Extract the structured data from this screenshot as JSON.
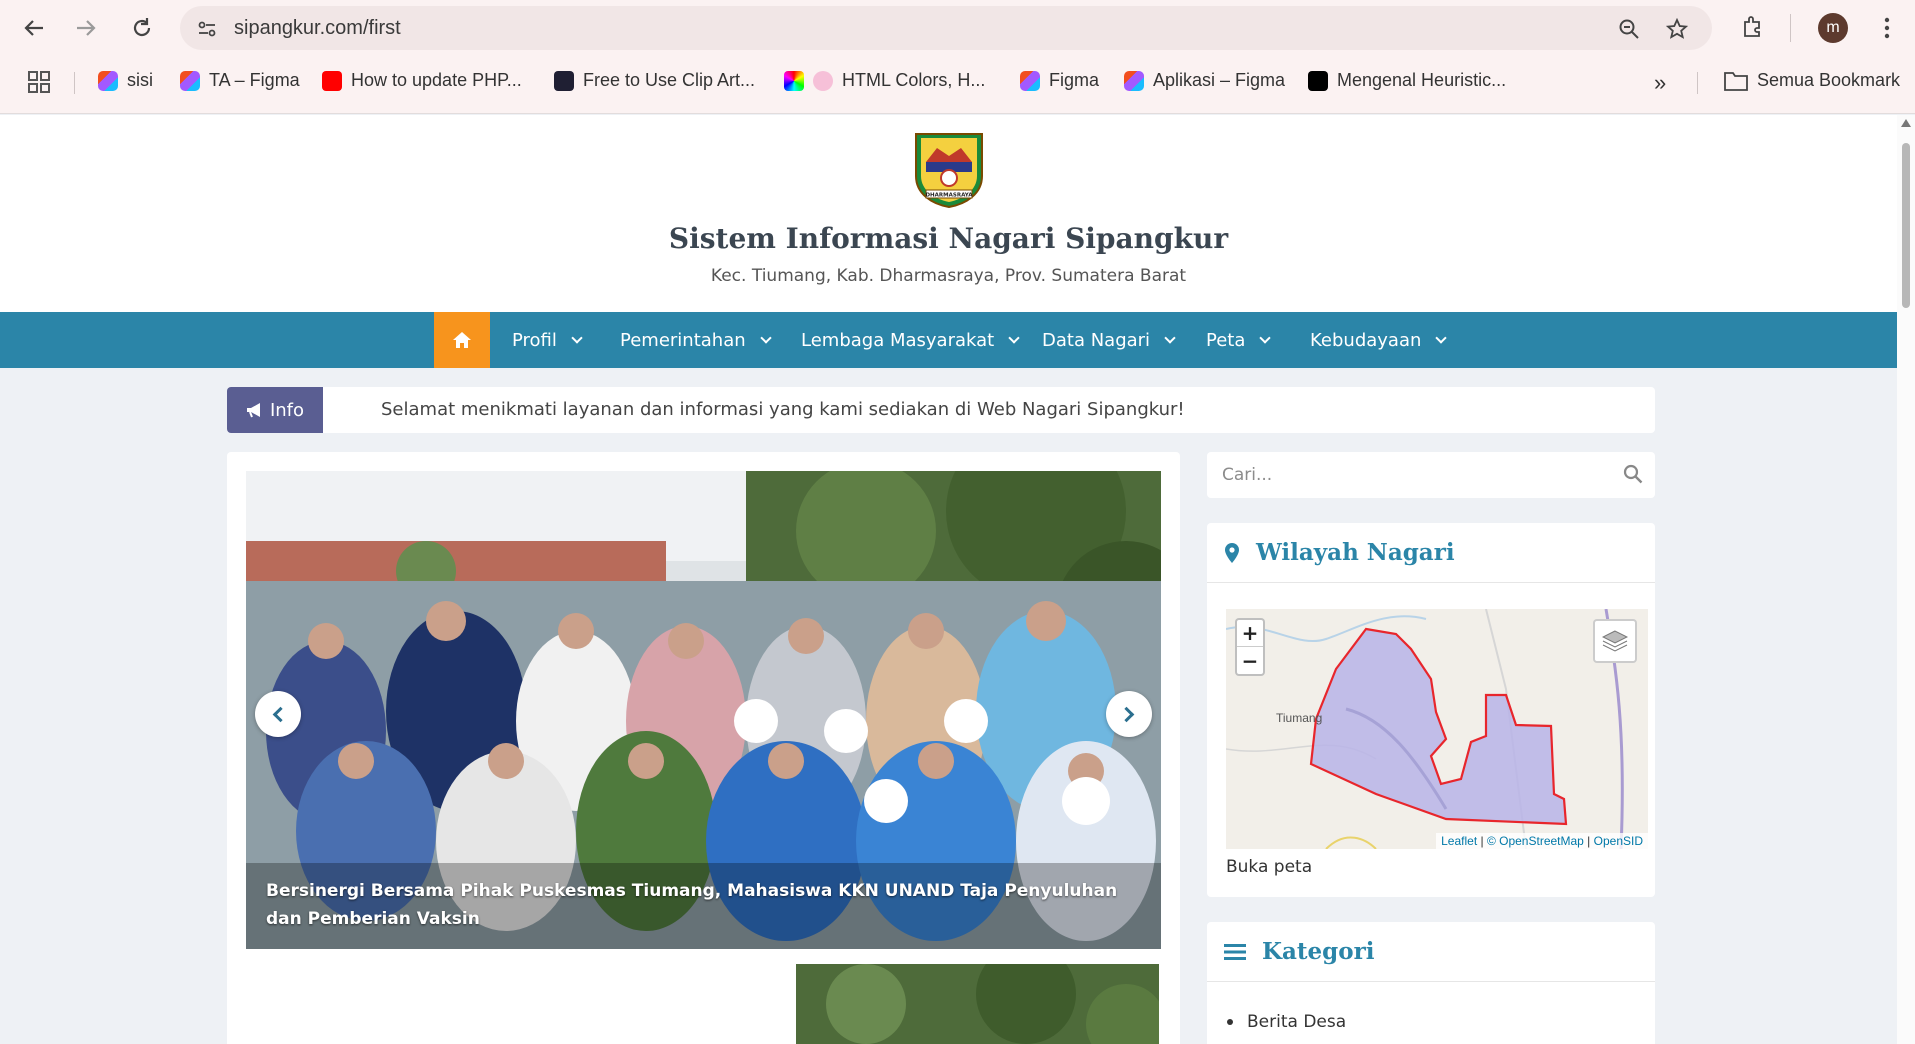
{
  "browser": {
    "url": "sipangkur.com/first",
    "profile_initial": "m",
    "bookmarks": [
      {
        "label": "sisi",
        "icon": "figma"
      },
      {
        "label": "TA – Figma",
        "icon": "figma"
      },
      {
        "label": "How to update PHP...",
        "icon": "youtube"
      },
      {
        "label": "Free to Use Clip Art...",
        "icon": "site"
      },
      {
        "label": "HTML Colors, H...",
        "icon": "colors"
      },
      {
        "label": "Figma",
        "icon": "figma"
      },
      {
        "label": "Aplikasi – Figma",
        "icon": "figma"
      },
      {
        "label": "Mengenal Heuristic...",
        "icon": "medium"
      }
    ],
    "all_bookmarks_label": "Semua Bookmark"
  },
  "site": {
    "title": "Sistem Informasi Nagari Sipangkur",
    "subtitle": "Kec. Tiumang, Kab. Dharmasraya, Prov. Sumatera Barat",
    "logo_text": "DHARMASRAYA"
  },
  "menu": {
    "items": [
      "Profil",
      "Pemerintahan",
      "Lembaga Masyarakat",
      "Data Nagari",
      "Peta",
      "Kebudayaan"
    ]
  },
  "info": {
    "badge": "Info",
    "text": "Selamat menikmati layanan dan informasi yang kami sediakan di Web Nagari Sipangkur!"
  },
  "slider": {
    "caption": "Bersinergi Bersama Pihak Puskesmas Tiumang, Mahasiswa KKN UNAND Taja Penyuluhan dan Pemberian Vaksin"
  },
  "search": {
    "placeholder": "Cari..."
  },
  "wilayah": {
    "title": "Wilayah Nagari",
    "map_place": "Tiumang",
    "zoom_in": "+",
    "zoom_out": "−",
    "attrib_leaflet": "Leaflet",
    "attrib_osm": "© OpenStreetMap",
    "attrib_opensid": "OpenSID",
    "open_map": "Buka peta"
  },
  "kategori": {
    "title": "Kategori",
    "items": [
      "Berita Desa"
    ]
  },
  "colors": {
    "menu_bg": "#2b85a8",
    "home_btn": "#f7941d",
    "info_badge": "#5a5e92",
    "boundary": "#e8262c"
  }
}
